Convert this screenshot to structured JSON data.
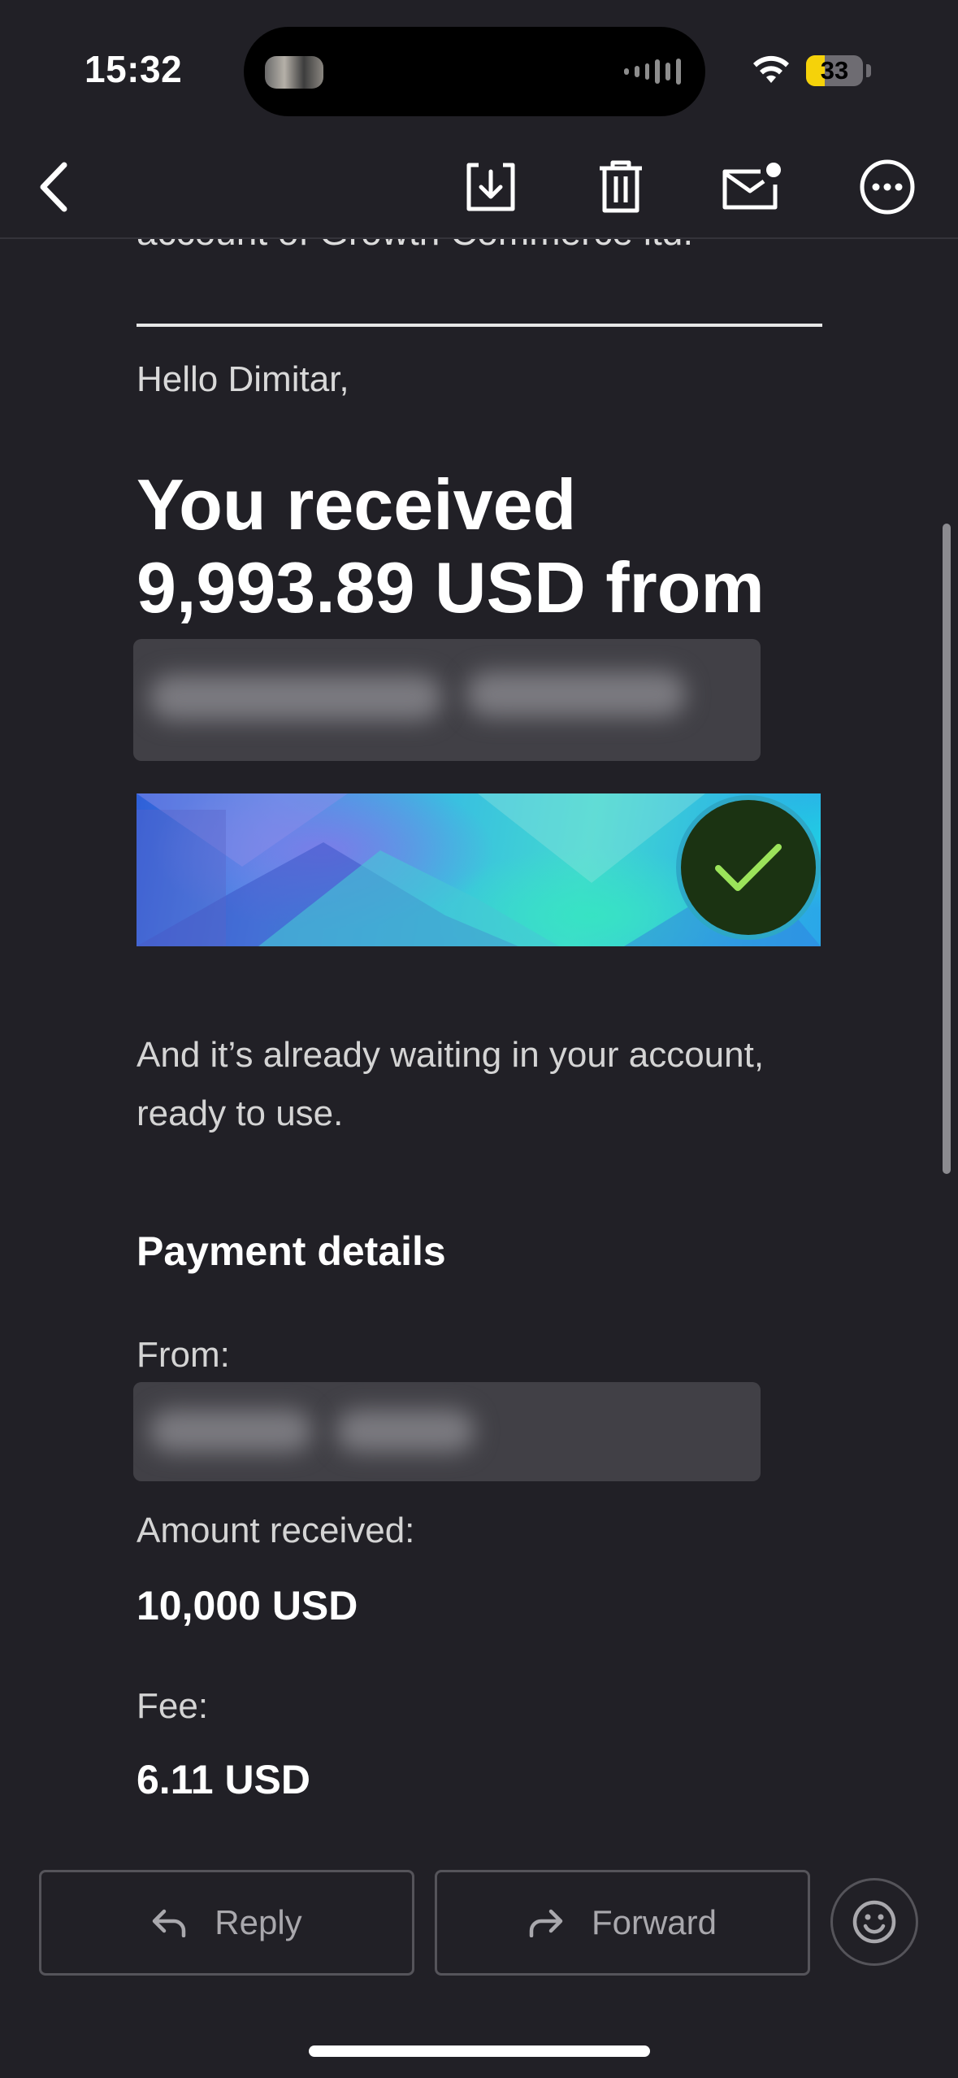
{
  "status_bar": {
    "time": "15:32",
    "battery_level": "33",
    "battery_fraction": 0.33,
    "battery_color": "#f5d20a"
  },
  "toolbar": {
    "icons": [
      "back-icon",
      "archive-icon",
      "trash-icon",
      "mark-unread-icon",
      "more-icon"
    ]
  },
  "email": {
    "clipped_line": "account of Growth Commerce ltd.",
    "greeting": "Hello Dimitar,",
    "headline_line1": "You received",
    "headline_line2": "9,993.89 USD from",
    "body": "And it’s already waiting in your account, ready to use.",
    "payment_details": {
      "title": "Payment details",
      "from_label": "From:",
      "amount_label": "Amount received:",
      "amount_value": "10,000 USD",
      "fee_label": "Fee:",
      "fee_value": "6.11 USD"
    },
    "check_color": "#9be35a"
  },
  "actions": {
    "reply_label": "Reply",
    "forward_label": "Forward"
  }
}
